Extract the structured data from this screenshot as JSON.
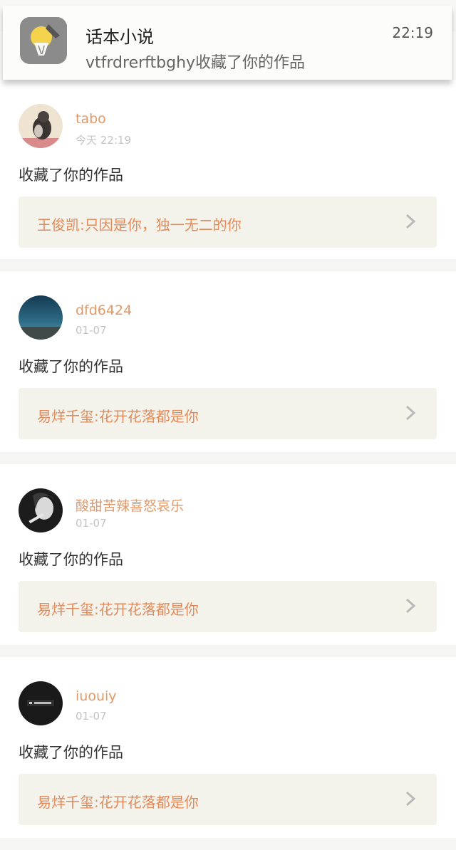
{
  "notification": {
    "app_name": "话本小说",
    "time": "22:19",
    "message": "vtfrdrerftbghy收藏了你的作品"
  },
  "feed": [
    {
      "username": "tabo",
      "date": "今天 22:19",
      "action": "收藏了你的作品",
      "work_title": "王俊凯:只因是你，独一无二的你"
    },
    {
      "username": "dfd6424",
      "date": "01-07",
      "action": "收藏了你的作品",
      "work_title": "易烊千玺:花开花落都是你"
    },
    {
      "username": "酸甜苦辣喜怒哀乐",
      "date": "01-07",
      "action": "收藏了你的作品",
      "work_title": "易烊千玺:花开花落都是你"
    },
    {
      "username": "iuouiy",
      "date": "01-07",
      "action": "收藏了你的作品",
      "work_title": "易烊千玺:花开花落都是你"
    }
  ],
  "colors": {
    "username": "#e09a6a",
    "work_title": "#e38a5a",
    "work_bg": "#f3f3ec",
    "page_bg": "#f5f5f3"
  }
}
